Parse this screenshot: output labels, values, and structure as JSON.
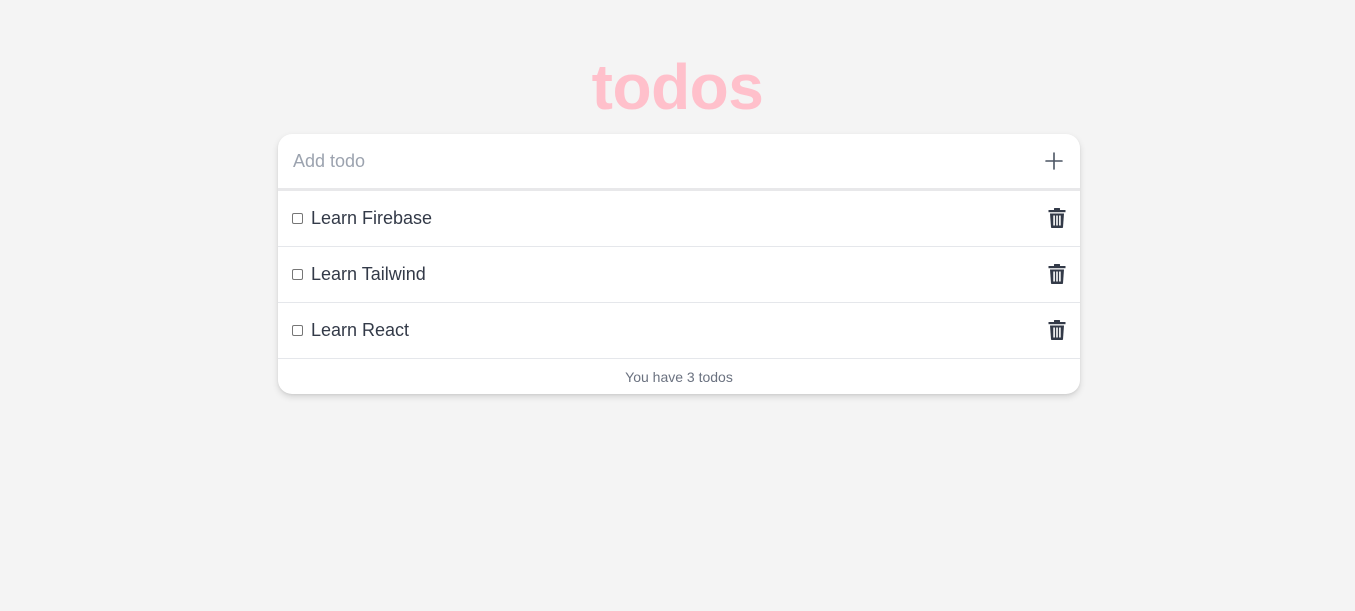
{
  "header": {
    "title": "todos",
    "title_color": "#ffc0cb"
  },
  "add_todo": {
    "placeholder": "Add todo",
    "value": "",
    "button_icon": "plus-icon"
  },
  "todos": [
    {
      "label": "Learn Firebase",
      "checked": false,
      "delete_icon": "trash-icon"
    },
    {
      "label": "Learn Tailwind",
      "checked": false,
      "delete_icon": "trash-icon"
    },
    {
      "label": "Learn React",
      "checked": false,
      "delete_icon": "trash-icon"
    }
  ],
  "footer": {
    "summary": "You have 3 todos"
  },
  "colors": {
    "background": "#f4f4f4",
    "card": "#ffffff",
    "text": "#333a48",
    "muted": "#6b7280",
    "placeholder": "#9ca3af"
  }
}
